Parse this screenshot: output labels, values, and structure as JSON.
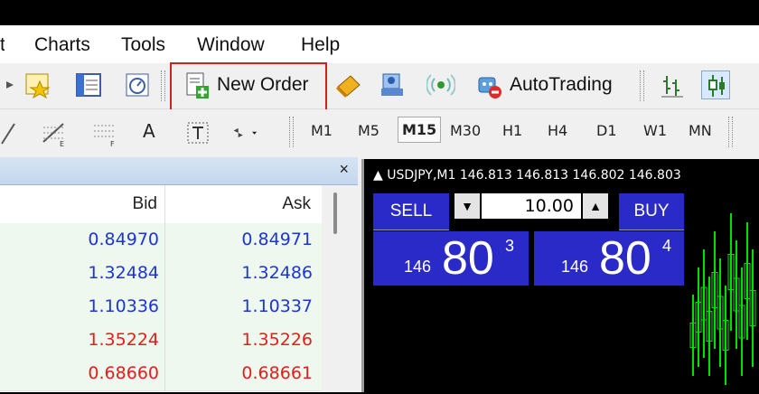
{
  "menu": {
    "items": [
      "Charts",
      "Tools",
      "Window",
      "Help"
    ]
  },
  "toolbar": {
    "new_order_label": "New Order",
    "autotrading_label": "AutoTrading",
    "icons": [
      "market-watch-icon",
      "navigator-icon",
      "data-window-icon",
      "new-order-icon",
      "metaeditor-icon",
      "signals-icon",
      "autotrading-icon"
    ]
  },
  "timeframes": [
    "M1",
    "M5",
    "M15",
    "M30",
    "H1",
    "H4",
    "D1",
    "W1",
    "MN"
  ],
  "drawing_tools": {
    "text_label": "A"
  },
  "market_watch": {
    "columns": {
      "bid": "Bid",
      "ask": "Ask"
    },
    "rows": [
      {
        "bid": "0.84970",
        "ask": "0.84971",
        "color": "blue"
      },
      {
        "bid": "1.32484",
        "ask": "1.32486",
        "color": "blue"
      },
      {
        "bid": "1.10336",
        "ask": "1.10337",
        "color": "blue"
      },
      {
        "bid": "1.35224",
        "ask": "1.35226",
        "color": "red"
      },
      {
        "bid": "0.68660",
        "ask": "0.68661",
        "color": "red"
      }
    ],
    "close_glyph": "×"
  },
  "chart": {
    "header": "▲ USDJPY,M1  146.813 146.813 146.802 146.803",
    "trade_panel": {
      "sell_label": "SELL",
      "buy_label": "BUY",
      "lot_value": "10.00",
      "sell_price": {
        "prefix": "146",
        "big": "80",
        "sup": "3"
      },
      "buy_price": {
        "prefix": "146",
        "big": "80",
        "sup": "4"
      }
    }
  },
  "colors": {
    "highlight": "#d21f1f",
    "trade_blue": "#2a2ac8",
    "bid_blue": "#1c35d6",
    "bid_red": "#e0201a",
    "candle_green": "#00e000"
  }
}
